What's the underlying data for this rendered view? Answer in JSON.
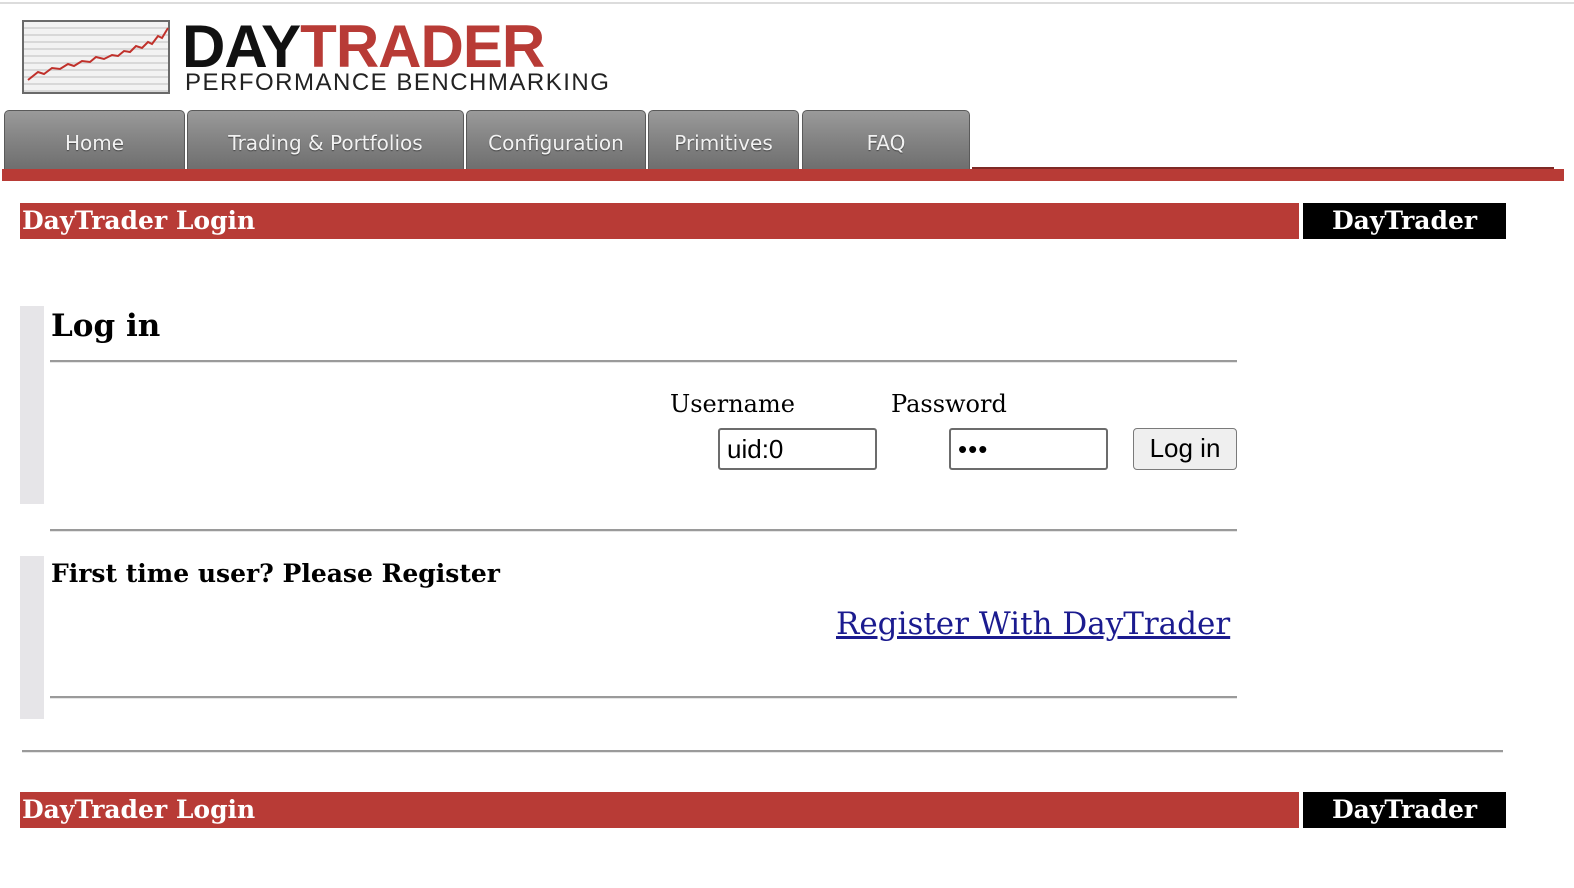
{
  "header": {
    "logo": {
      "word_day": "DAY",
      "word_trader": "TRADER",
      "subtitle": "PERFORMANCE BENCHMARKING"
    }
  },
  "nav": {
    "tabs": [
      {
        "label": "Home"
      },
      {
        "label": "Trading & Portfolios"
      },
      {
        "label": "Configuration"
      },
      {
        "label": "Primitives"
      },
      {
        "label": "FAQ"
      }
    ]
  },
  "top_bar": {
    "title": "DayTrader Login",
    "brand": "DayTrader"
  },
  "login": {
    "heading": "Log in",
    "username_label": "Username",
    "password_label": "Password",
    "username_value": "uid:0",
    "password_value": "•••",
    "submit_label": "Log in"
  },
  "register": {
    "question": "First time user?  Please Register",
    "link_label": "Register With DayTrader"
  },
  "bottom_bar": {
    "title": "DayTrader Login",
    "brand": "DayTrader"
  },
  "colors": {
    "accent_red": "#b83b36",
    "link_blue": "#1b1b8f",
    "tab_gray": "#858585"
  }
}
